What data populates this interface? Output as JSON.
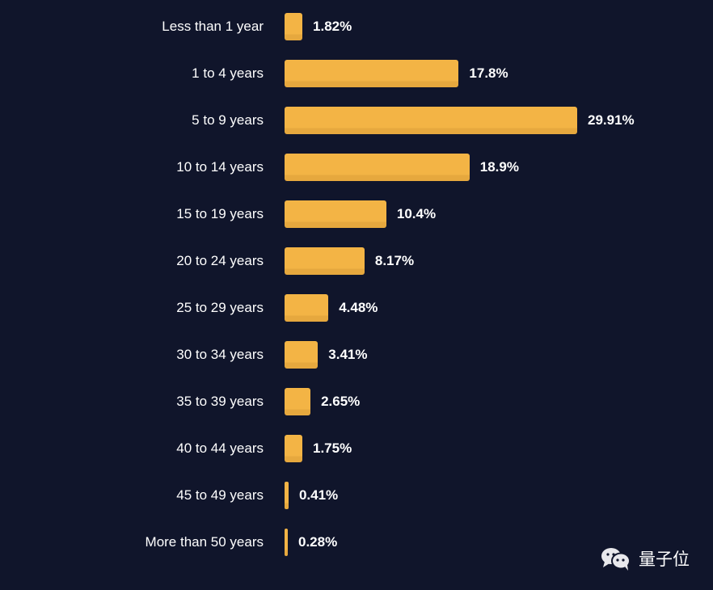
{
  "chart_data": {
    "type": "bar",
    "orientation": "horizontal",
    "title": "",
    "xlabel": "",
    "ylabel": "",
    "categories": [
      "Less than 1 year",
      "1 to 4 years",
      "5 to 9 years",
      "10 to 14 years",
      "15 to 19 years",
      "20 to 24 years",
      "25 to 29 years",
      "30 to 34 years",
      "35 to 39 years",
      "40 to 44 years",
      "45 to 49 years",
      "More than 50 years"
    ],
    "values": [
      1.82,
      17.8,
      29.91,
      18.9,
      10.4,
      8.17,
      4.48,
      3.41,
      2.65,
      1.75,
      0.41,
      0.28
    ],
    "value_labels": [
      "1.82%",
      "17.8%",
      "29.91%",
      "18.9%",
      "10.4%",
      "8.17%",
      "4.48%",
      "3.41%",
      "2.65%",
      "1.75%",
      "0.41%",
      "0.28%"
    ],
    "unit": "%",
    "grid": false,
    "legend": "none",
    "bar_color": "#f3b445",
    "background_color": "#10152b"
  },
  "watermark": {
    "text": "量子位",
    "icon": "wechat-icon"
  }
}
